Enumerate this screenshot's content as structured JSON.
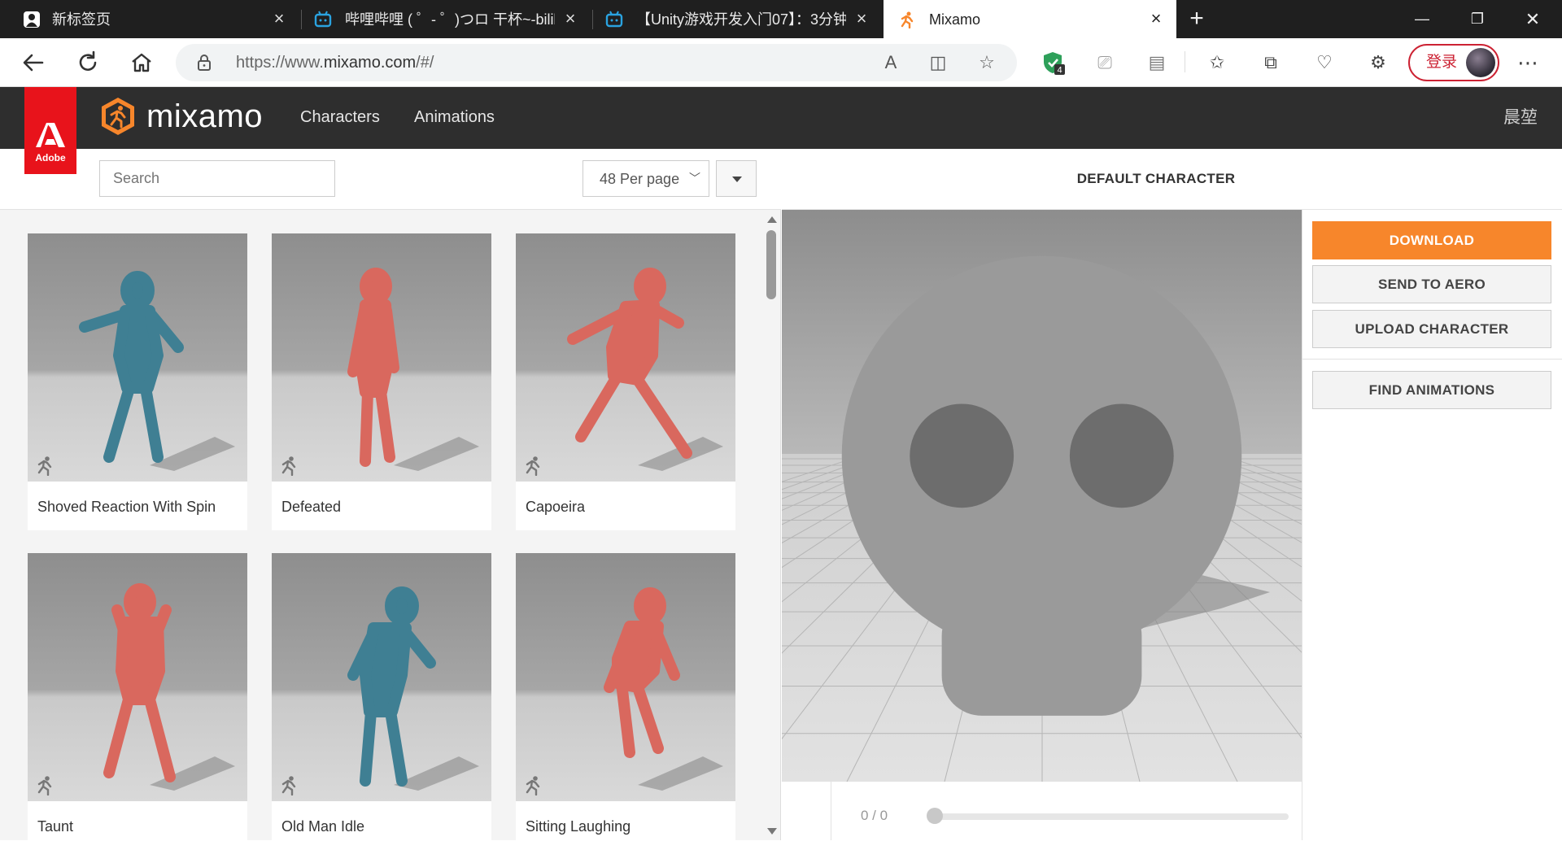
{
  "browser": {
    "tabs": [
      {
        "title": "新标签页",
        "active": false
      },
      {
        "title": "哔哩哔哩 ( ゜- ゜)つロ 干杯~-bilibili",
        "active": false
      },
      {
        "title": "【Unity游戏开发入门07】：3分钟",
        "active": false
      },
      {
        "title": "Mixamo",
        "active": true
      }
    ],
    "url_prefix": "https://www.",
    "url_domain": "mixamo.com",
    "url_path": "/#/",
    "extension_badge": "4",
    "login_label": "登录"
  },
  "header": {
    "adobe_label": "Adobe",
    "app_name": "mixamo",
    "nav": [
      {
        "label": "Characters"
      },
      {
        "label": "Animations"
      }
    ],
    "user_name": "晨堃"
  },
  "library": {
    "search_placeholder": "Search",
    "per_page": "48 Per page",
    "cards": [
      {
        "label": "Shoved Reaction With Spin",
        "color": "#3f7f93"
      },
      {
        "label": "Defeated",
        "color": "#d9685e"
      },
      {
        "label": "Capoeira",
        "color": "#d9685e"
      },
      {
        "label": "Taunt",
        "color": "#d9685e"
      },
      {
        "label": "Old Man Idle",
        "color": "#3f7f93"
      },
      {
        "label": "Sitting Laughing",
        "color": "#d9685e"
      }
    ]
  },
  "preview": {
    "title": "DEFAULT CHARACTER",
    "frame_counter": "0 / 0",
    "buttons": {
      "download": "DOWNLOAD",
      "send_to_aero": "SEND TO AERO",
      "upload_character": "UPLOAD CHARACTER",
      "find_animations": "FIND ANIMATIONS"
    }
  },
  "colors": {
    "accent": "#f7862b",
    "adobe_red": "#e8131b",
    "header_bg": "#2e2e2e",
    "figure_red": "#d9685e",
    "figure_blue": "#3f7f93"
  }
}
